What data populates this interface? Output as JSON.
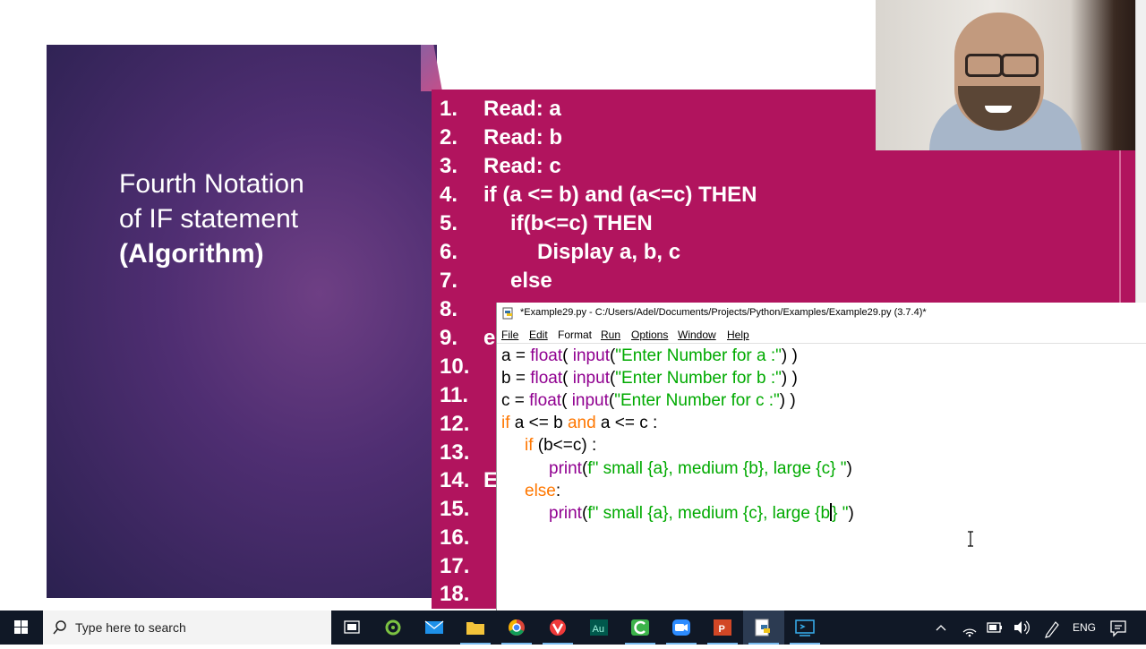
{
  "slide": {
    "title_line1": "Fourth Notation",
    "title_line2": "of IF statement",
    "title_line3": "(Algorithm)",
    "algorithm": [
      {
        "num": "1.",
        "text": "Read: a"
      },
      {
        "num": "2.",
        "text": "Read: b"
      },
      {
        "num": "3.",
        "text": "Read: c"
      },
      {
        "num": "4.",
        "text": "if (a <= b) and (a<=c) THEN"
      },
      {
        "num": "5.",
        "text": "if(b<=c) THEN"
      },
      {
        "num": "6.",
        "text": "Display a, b, c"
      },
      {
        "num": "7.",
        "text": "else"
      },
      {
        "num": "8.",
        "text": ""
      },
      {
        "num": "9.",
        "text": "e"
      },
      {
        "num": "10.",
        "text": ""
      },
      {
        "num": "11.",
        "text": ""
      },
      {
        "num": "12.",
        "text": ""
      },
      {
        "num": "13.",
        "text": ""
      },
      {
        "num": "14.",
        "text": "E"
      },
      {
        "num": "15.",
        "text": ""
      },
      {
        "num": "16.",
        "text": ""
      },
      {
        "num": "17.",
        "text": ""
      },
      {
        "num": "18.",
        "text": ""
      }
    ],
    "colors": {
      "panel": "#b1145e",
      "left_panel": "#4f2e72"
    }
  },
  "idle": {
    "title": "*Example29.py - C:/Users/Adel/Documents/Projects/Python/Examples/Example29.py (3.7.4)*",
    "menu": [
      "File",
      "Edit",
      "Format",
      "Run",
      "Options",
      "Window",
      "Help"
    ],
    "code": {
      "l1": {
        "v": "a = ",
        "fn": "float",
        "p1": "( ",
        "fn2": "input",
        "p2": "(",
        "s": "\"Enter Number for a :\"",
        "p3": ") )"
      },
      "l2": {
        "v": "b = ",
        "fn": "float",
        "p1": "( ",
        "fn2": "input",
        "p2": "(",
        "s": "\"Enter Number for b :\"",
        "p3": ") )"
      },
      "l3": {
        "v": "c = ",
        "fn": "float",
        "p1": "( ",
        "fn2": "input",
        "p2": "(",
        "s": "\"Enter Number for c :\"",
        "p3": ") )"
      },
      "l4": {
        "kw": "if",
        "a": " a <= b ",
        "kw2": "and",
        "b": " a <= c :"
      },
      "l5": {
        "kw": "if",
        "a": " (b<=c) :"
      },
      "l6": {
        "fn": "print",
        "p": "(",
        "s": "f\" small {a}, medium {b}, large {c} \"",
        "e": ")"
      },
      "l7": {
        "kw": "else",
        "a": ":"
      },
      "l8": {
        "fn": "print",
        "p": "(",
        "s1": "f\" small {a}, medium {c}, large {b",
        "s2": "} \"",
        "e": ")"
      }
    },
    "colors": {
      "keyword": "#ff7700",
      "builtin": "#900090",
      "string": "#00aa00"
    }
  },
  "taskbar": {
    "search_placeholder": "Type here to search",
    "language": "ENG",
    "apps": [
      "task-view",
      "app-green",
      "mail",
      "file-explorer",
      "chrome",
      "vivaldi",
      "audition",
      "camtasia",
      "zoom",
      "powerpoint",
      "python-idle",
      "remote-desktop"
    ]
  }
}
